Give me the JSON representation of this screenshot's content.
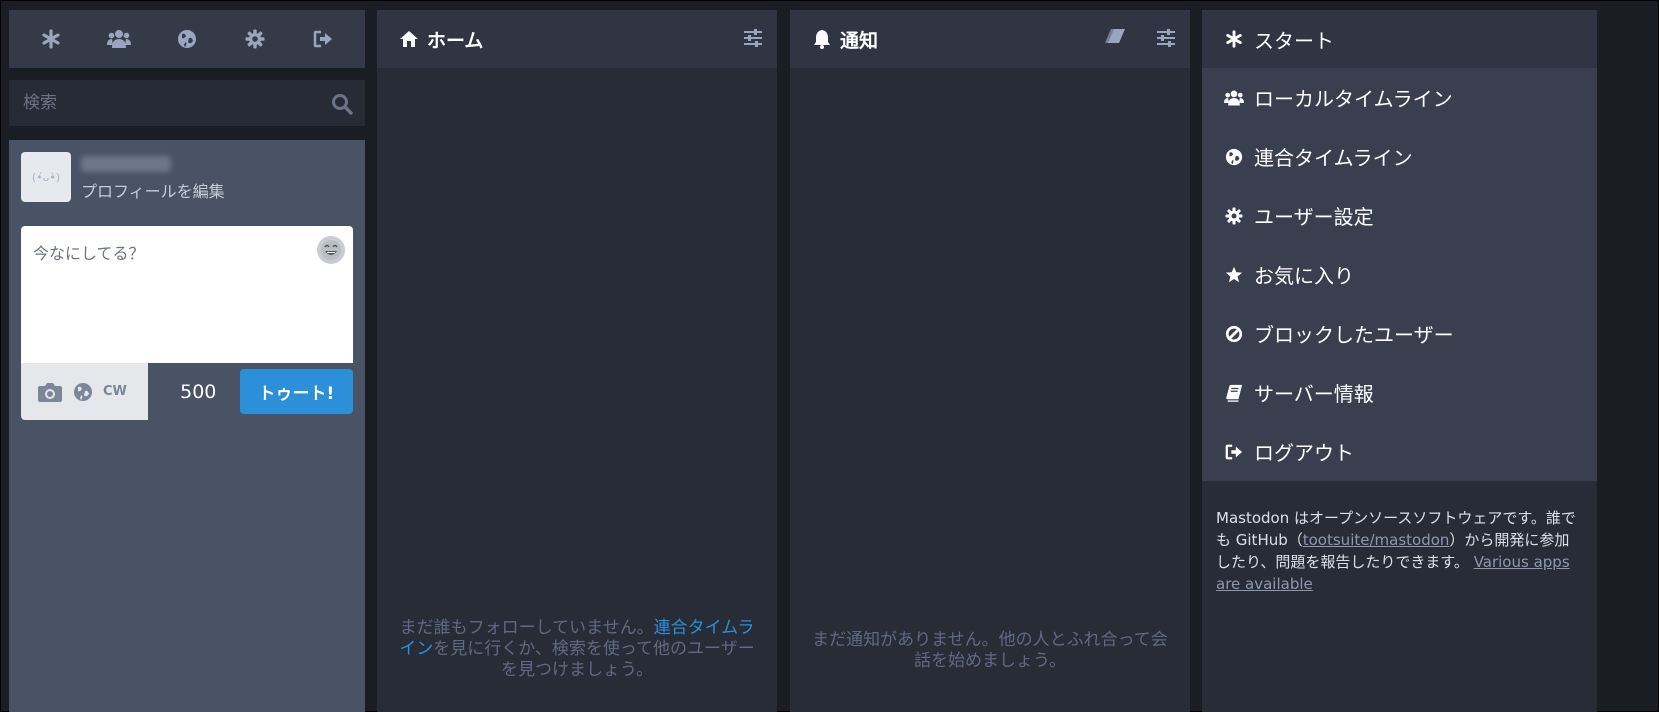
{
  "compose_nav": {
    "items": [
      {
        "icon": "asterisk-icon"
      },
      {
        "icon": "users-icon"
      },
      {
        "icon": "globe-icon"
      },
      {
        "icon": "gear-icon"
      },
      {
        "icon": "sign-out-icon"
      }
    ]
  },
  "search": {
    "placeholder": "検索"
  },
  "profile": {
    "edit_label": "プロフィールを編集"
  },
  "compose": {
    "placeholder": "今なにしてる？",
    "cw_label": "CW",
    "counter": "500",
    "submit_label": "トゥート!"
  },
  "home": {
    "title": "ホーム",
    "empty_before": "まだ誰もフォローしていません。",
    "empty_link": "連合タイムライン",
    "empty_after": "を見に行くか、検索を使って他のユーザーを見つけましょう。"
  },
  "notifications": {
    "title": "通知",
    "empty": "まだ通知がありません。他の人とふれ合って会話を始めましょう。"
  },
  "getting_started": {
    "header": "スタート",
    "items": [
      {
        "label": "ローカルタイムライン",
        "icon": "users-icon"
      },
      {
        "label": "連合タイムライン",
        "icon": "globe-icon"
      },
      {
        "label": "ユーザー設定",
        "icon": "gear-icon"
      },
      {
        "label": "お気に入り",
        "icon": "star-icon"
      },
      {
        "label": "ブロックしたユーザー",
        "icon": "ban-icon"
      },
      {
        "label": "サーバー情報",
        "icon": "book-icon"
      },
      {
        "label": "ログアウト",
        "icon": "sign-out-icon"
      }
    ],
    "footer_1": "Mastodon はオープンソースソフトウェアです。誰でも GitHub（",
    "footer_link": "tootsuite/mastodon",
    "footer_2": "）から開発に参加したり、問題を報告したりできます。",
    "footer_apps": "Various apps are available"
  },
  "colors": {
    "accent": "#2b90d9",
    "background": "#282c37",
    "header": "#313543"
  }
}
